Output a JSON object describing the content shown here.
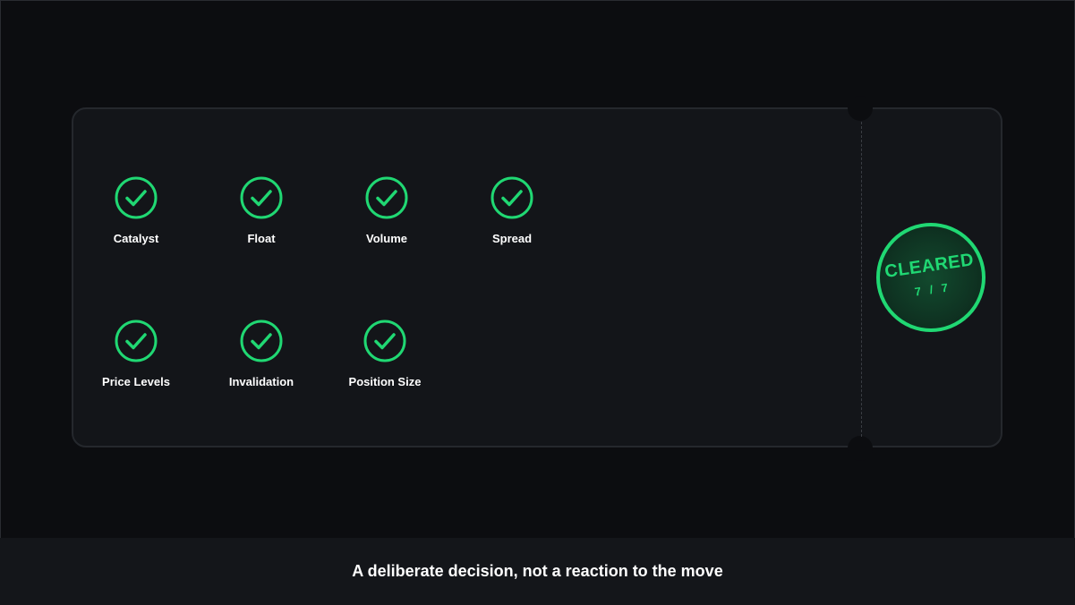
{
  "checklist": {
    "items": [
      {
        "label": "Catalyst",
        "status": "checked",
        "icon": "check-circle-icon"
      },
      {
        "label": "Float",
        "status": "checked",
        "icon": "check-circle-icon"
      },
      {
        "label": "Volume",
        "status": "checked",
        "icon": "check-circle-icon"
      },
      {
        "label": "Spread",
        "status": "checked",
        "icon": "check-circle-icon"
      },
      {
        "label": "Price Levels",
        "status": "checked",
        "icon": "check-circle-icon"
      },
      {
        "label": "Invalidation",
        "status": "checked",
        "icon": "check-circle-icon"
      },
      {
        "label": "Position Size",
        "status": "checked",
        "icon": "check-circle-icon"
      }
    ]
  },
  "stamp": {
    "title": "CLEARED",
    "count": "7 / 7"
  },
  "caption": {
    "text": "A deliberate decision, not a reaction to the move"
  },
  "colors": {
    "accent": "#20d873",
    "background": "#0c0d10",
    "card": "#131519",
    "text": "#ffffff"
  }
}
